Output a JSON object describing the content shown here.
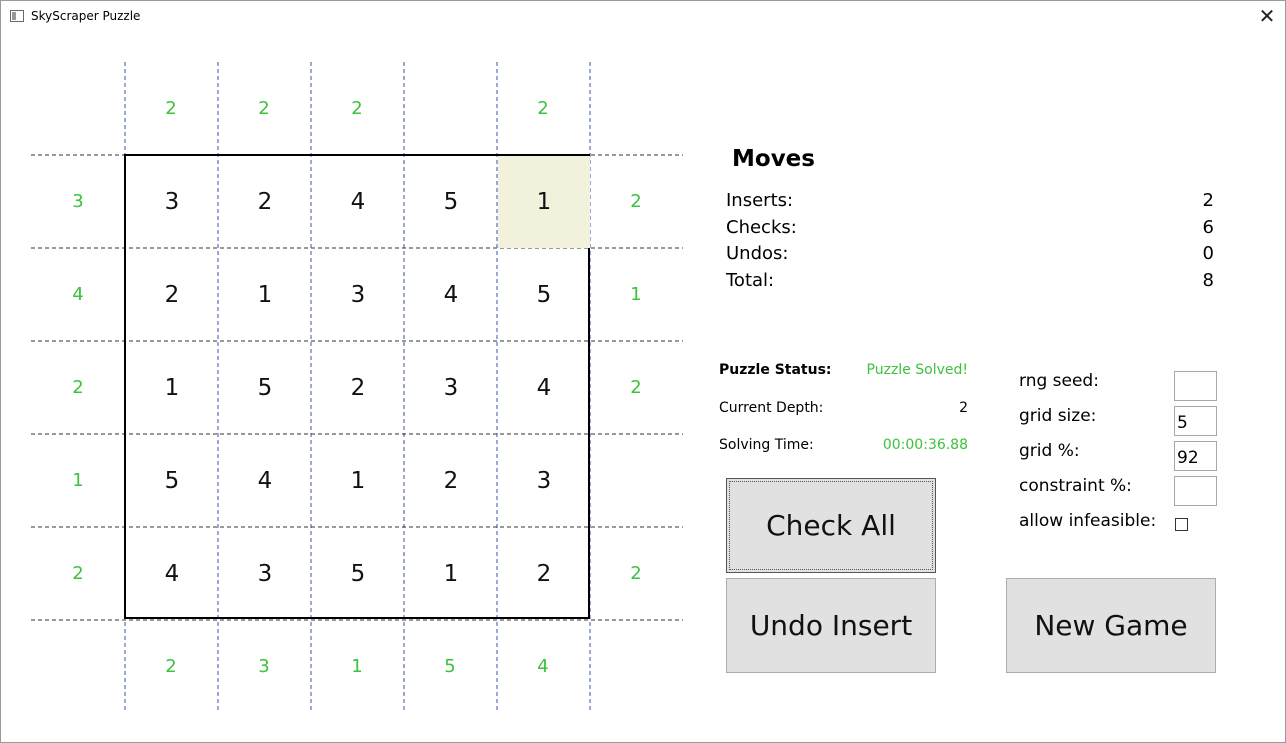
{
  "window": {
    "title": "SkyScraper Puzzle",
    "close_glyph": "✕"
  },
  "puzzle": {
    "clues_top": [
      "2",
      "2",
      "2",
      "",
      "2"
    ],
    "clues_bottom": [
      "2",
      "3",
      "1",
      "5",
      "4"
    ],
    "clues_left": [
      "3",
      "4",
      "2",
      "1",
      "2"
    ],
    "clues_right": [
      "2",
      "1",
      "2",
      "",
      "2"
    ],
    "grid": [
      [
        "3",
        "2",
        "4",
        "5",
        "1"
      ],
      [
        "2",
        "1",
        "3",
        "4",
        "5"
      ],
      [
        "1",
        "5",
        "2",
        "3",
        "4"
      ],
      [
        "5",
        "4",
        "1",
        "2",
        "3"
      ],
      [
        "4",
        "3",
        "5",
        "1",
        "2"
      ]
    ],
    "highlighted_cell": {
      "row": 0,
      "col": 4
    }
  },
  "moves": {
    "title": "Moves",
    "inserts_label": "Inserts:",
    "inserts_value": "2",
    "checks_label": "Checks:",
    "checks_value": "6",
    "undos_label": "Undos:",
    "undos_value": "0",
    "total_label": "Total:",
    "total_value": "8"
  },
  "status": {
    "puzzle_status_label": "Puzzle Status:",
    "puzzle_status_value": "Puzzle Solved!",
    "depth_label": "Current Depth:",
    "depth_value": "2",
    "time_label": "Solving Time:",
    "time_value": "00:00:36.88"
  },
  "settings": {
    "rng_seed_label": "rng seed:",
    "rng_seed_value": "",
    "grid_size_label": "grid size:",
    "grid_size_value": "5",
    "grid_pct_label": "grid %:",
    "grid_pct_value": "92",
    "constraint_label": "constraint %:",
    "constraint_value": "",
    "allow_infeasible_label": "allow infeasible:",
    "allow_infeasible_checked": false
  },
  "buttons": {
    "check_all": "Check All",
    "undo_insert": "Undo Insert",
    "new_game": "New Game"
  },
  "colors": {
    "clue": "#3cc23c",
    "highlight": "#f2f2dc",
    "button_bg": "#e1e1e1"
  }
}
